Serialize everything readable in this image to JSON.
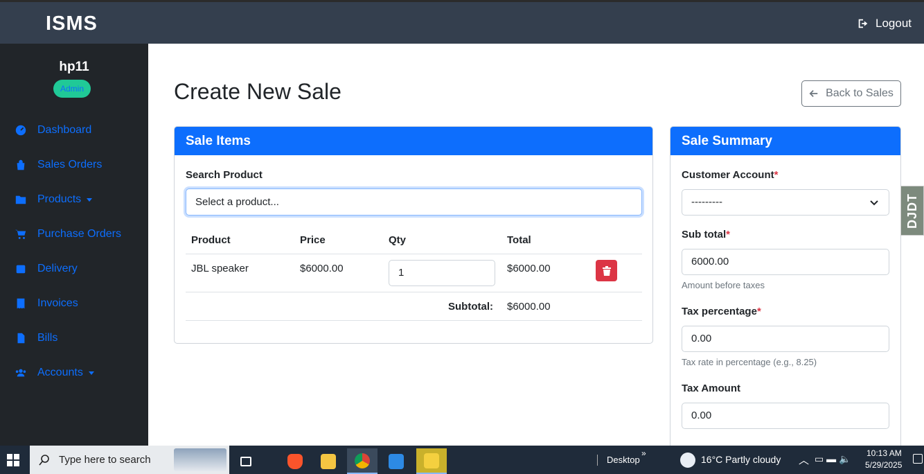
{
  "app": {
    "brand": "ISMS",
    "logout_label": "Logout"
  },
  "user": {
    "name": "hp11",
    "role": "Admin"
  },
  "sidebar": {
    "items": [
      {
        "label": "Dashboard",
        "icon": "dashboard-icon"
      },
      {
        "label": "Sales Orders",
        "icon": "shopping-bag-icon"
      },
      {
        "label": "Products",
        "icon": "folder-icon",
        "dropdown": true
      },
      {
        "label": "Purchase Orders",
        "icon": "cart-icon"
      },
      {
        "label": "Delivery",
        "icon": "calendar-icon"
      },
      {
        "label": "Invoices",
        "icon": "receipt-icon"
      },
      {
        "label": "Bills",
        "icon": "document-icon"
      },
      {
        "label": "Accounts",
        "icon": "users-icon",
        "dropdown": true
      }
    ]
  },
  "page": {
    "title": "Create New Sale",
    "back_label": "Back to Sales"
  },
  "sale_items": {
    "header": "Sale Items",
    "search_label": "Search Product",
    "search_placeholder": "Select a product...",
    "columns": [
      "Product",
      "Price",
      "Qty",
      "Total"
    ],
    "rows": [
      {
        "product": "JBL speaker",
        "price": "$6000.00",
        "qty": "1",
        "total": "$6000.00"
      }
    ],
    "subtotal_label": "Subtotal:",
    "subtotal_value": "$6000.00"
  },
  "summary": {
    "header": "Sale Summary",
    "customer_label": "Customer Account",
    "customer_value": "---------",
    "subtotal_label": "Sub total",
    "subtotal_value": "6000.00",
    "subtotal_help": "Amount before taxes",
    "tax_pct_label": "Tax percentage",
    "tax_pct_value": "0.00",
    "tax_pct_help": "Tax rate in percentage (e.g., 8.25)",
    "tax_amount_label": "Tax Amount",
    "tax_amount_value": "0.00",
    "required_mark": "*"
  },
  "side_tab": {
    "label": "DJDT"
  },
  "taskbar": {
    "search_placeholder": "Type here to search",
    "desktop_label": "Desktop",
    "weather": "16°C  Partly cloudy",
    "time": "10:13 AM",
    "date": "5/29/2025"
  },
  "colors": {
    "primary": "#0d6efd",
    "danger": "#dc3545",
    "navbar": "#343f4e",
    "sidebar": "#212529",
    "badge": "#20c997"
  }
}
